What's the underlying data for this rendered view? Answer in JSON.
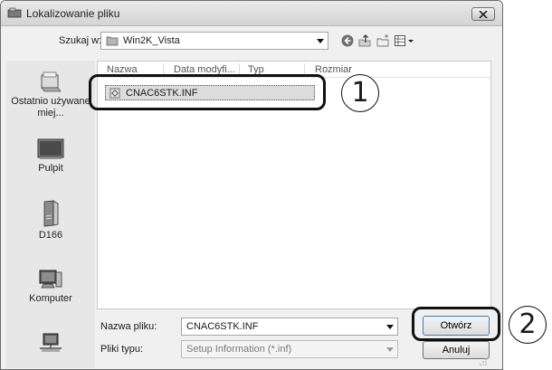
{
  "dialog": {
    "title": "Lokalizowanie pliku",
    "close_label": "✕"
  },
  "toolbar": {
    "look_in_label": "Szukaj w:",
    "look_in_value": "Win2K_Vista",
    "buttons": [
      "back-icon",
      "up-folder-icon",
      "new-folder-icon",
      "views-menu-icon"
    ]
  },
  "places": [
    {
      "label": "Ostatnio używane miej...",
      "icon": "recent-places-icon"
    },
    {
      "label": "Pulpit",
      "icon": "desktop-icon"
    },
    {
      "label": "D166",
      "icon": "user-folder-icon"
    },
    {
      "label": "Komputer",
      "icon": "computer-icon"
    },
    {
      "label": "",
      "icon": "network-icon"
    }
  ],
  "file_list": {
    "columns": [
      "Nazwa",
      "Data modyfi...",
      "Typ",
      "Rozmiar"
    ],
    "items": [
      {
        "name": "CNAC6STK.INF",
        "icon": "setup-info-file-icon",
        "selected": true
      }
    ]
  },
  "filename": {
    "label": "Nazwa pliku:",
    "value": "CNAC6STK.INF"
  },
  "filetype": {
    "label": "Pliki typu:",
    "value": "Setup Information (*.inf)"
  },
  "buttons": {
    "open": "Otwórz",
    "cancel": "Anuluj"
  },
  "annotations": {
    "step1": "1",
    "step2": "2"
  }
}
